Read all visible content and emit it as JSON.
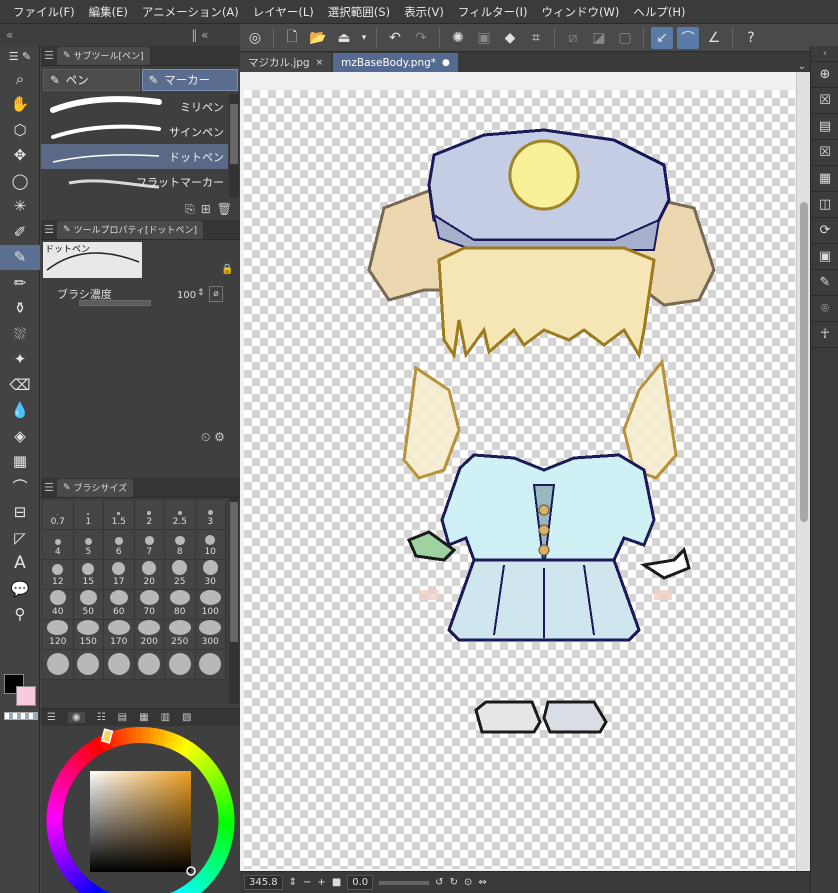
{
  "menu": [
    "ファイル(F)",
    "編集(E)",
    "アニメーション(A)",
    "レイヤー(L)",
    "選択範囲(S)",
    "表示(V)",
    "フィルター(I)",
    "ウィンドウ(W)",
    "ヘルプ(H)"
  ],
  "subtool_panel": {
    "title": "サブツール[ペン]",
    "tabs": [
      {
        "label": "ペン",
        "active": false
      },
      {
        "label": "マーカー",
        "active": true
      }
    ],
    "brushes": [
      {
        "name": "ミリペン",
        "active": false
      },
      {
        "name": "サインペン",
        "active": false
      },
      {
        "name": "ドットペン",
        "active": true
      },
      {
        "name": "フラットマーカー",
        "active": false
      }
    ]
  },
  "tool_property": {
    "title": "ツールプロパティ[ドットペン]",
    "preview_label": "ドットペン",
    "density_label": "ブラシ濃度",
    "density_value": "100"
  },
  "brush_size": {
    "title": "ブラシサイズ",
    "sizes": [
      "0.7",
      "1",
      "1.5",
      "2",
      "2.5",
      "3",
      "4",
      "5",
      "6",
      "7",
      "8",
      "10",
      "12",
      "15",
      "17",
      "20",
      "25",
      "30",
      "40",
      "50",
      "60",
      "70",
      "80",
      "100",
      "120",
      "150",
      "170",
      "200",
      "250",
      "300",
      "",
      "",
      "",
      "",
      "",
      ""
    ]
  },
  "colors": {
    "main": "#000000",
    "sub": "#f9c9df",
    "wheel_hue": "#f0a020",
    "accent": "#5a6f92"
  },
  "document_tabs": [
    {
      "label": "マジカル.jpg",
      "active": false
    },
    {
      "label": "mzBaseBody.png*",
      "active": true
    }
  ],
  "status": {
    "zoom": "345.8",
    "angle": "0.0"
  }
}
